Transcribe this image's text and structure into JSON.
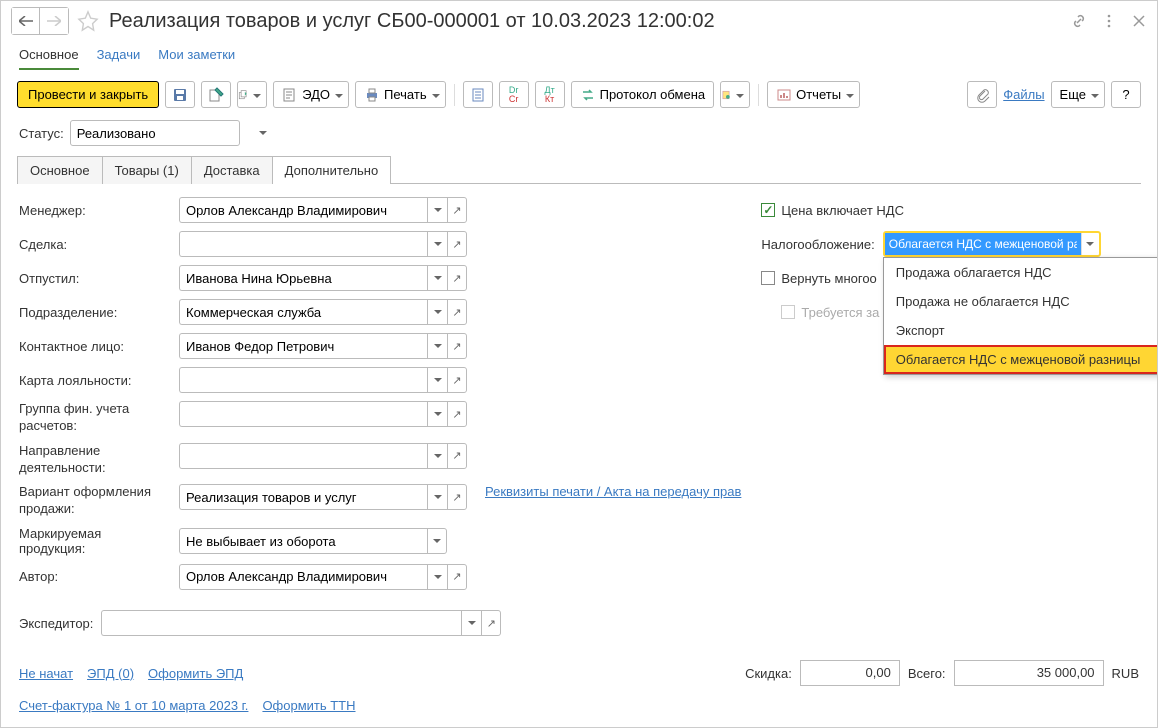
{
  "header": {
    "title": "Реализация товаров и услуг СБ00-000001 от 10.03.2023 12:00:02"
  },
  "topnav": {
    "main": "Основное",
    "tasks": "Задачи",
    "notes": "Мои заметки"
  },
  "toolbar": {
    "post_close": "Провести и закрыть",
    "edo": "ЭДО",
    "print": "Печать",
    "protocol": "Протокол обмена",
    "reports": "Отчеты",
    "files": "Файлы",
    "more": "Еще",
    "help": "?"
  },
  "status": {
    "label": "Статус:",
    "value": "Реализовано"
  },
  "subtabs": {
    "main": "Основное",
    "goods": "Товары (1)",
    "delivery": "Доставка",
    "additional": "Дополнительно"
  },
  "form": {
    "manager": {
      "label": "Менеджер:",
      "value": "Орлов Александр Владимирович"
    },
    "deal": {
      "label": "Сделка:",
      "value": ""
    },
    "released": {
      "label": "Отпустил:",
      "value": "Иванова Нина Юрьевна"
    },
    "department": {
      "label": "Подразделение:",
      "value": "Коммерческая служба"
    },
    "contact": {
      "label": "Контактное лицо:",
      "value": "Иванов Федор Петрович"
    },
    "loyalty": {
      "label": "Карта лояльности:",
      "value": ""
    },
    "fingroup": {
      "label": "Группа фин. учета расчетов:",
      "value": ""
    },
    "direction": {
      "label": "Направление деятельности:",
      "value": ""
    },
    "variant": {
      "label": "Вариант оформления продажи:",
      "value": "Реализация товаров и услуг"
    },
    "marked": {
      "label": "Маркируемая продукция:",
      "value": "Не выбывает из оборота"
    },
    "author": {
      "label": "Автор:",
      "value": "Орлов Александр Владимирович"
    },
    "expeditor": {
      "label": "Экспедитор:",
      "value": ""
    },
    "print_details_link": "Реквизиты печати / Акта на передачу прав"
  },
  "right": {
    "price_includes_vat": "Цена включает НДС",
    "taxation_label": "Налогообложение:",
    "taxation_value": "Облагается НДС с межценовой разни",
    "return_reusable": "Вернуть многоо",
    "deposit_required": "Требуется за",
    "dropdown": {
      "opt1": "Продажа облагается НДС",
      "opt2": "Продажа не облагается НДС",
      "opt3": "Экспорт",
      "opt4": "Облагается НДС с межценовой разницы"
    }
  },
  "footer": {
    "not_started": "Не начат",
    "epd": "ЭПД (0)",
    "form_epd": "Оформить ЭПД",
    "discount_label": "Скидка:",
    "discount_value": "0,00",
    "total_label": "Всего:",
    "total_value": "35 000,00",
    "currency": "RUB",
    "invoice_link": "Счет-фактура № 1 от 10 марта 2023 г.",
    "form_ttn": "Оформить ТТН"
  }
}
